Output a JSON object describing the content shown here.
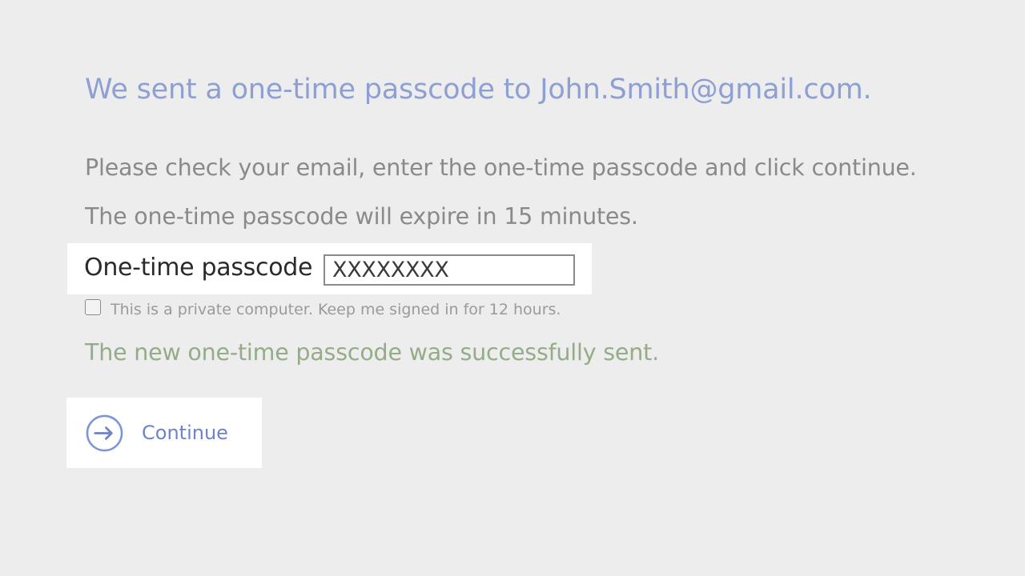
{
  "heading": "We sent a one-time passcode to John.Smith@gmail.com.",
  "instructions": [
    "Please check your email, enter the one-time passcode and click continue.",
    "The one-time passcode will expire in 15 minutes."
  ],
  "passcode": {
    "label": "One-time passcode",
    "value": "XXXXXXXX"
  },
  "remember": {
    "label": "This is a private computer. Keep me signed in for 12 hours.",
    "checked": false
  },
  "status": {
    "message": "The new one-time passcode was successfully sent.",
    "color": "#94ac88"
  },
  "continue": {
    "label": "Continue",
    "icon": "arrow-right-circle-icon"
  },
  "colors": {
    "background": "#ededed",
    "heading": "#8e9fd2",
    "accent": "#6f83c6"
  }
}
